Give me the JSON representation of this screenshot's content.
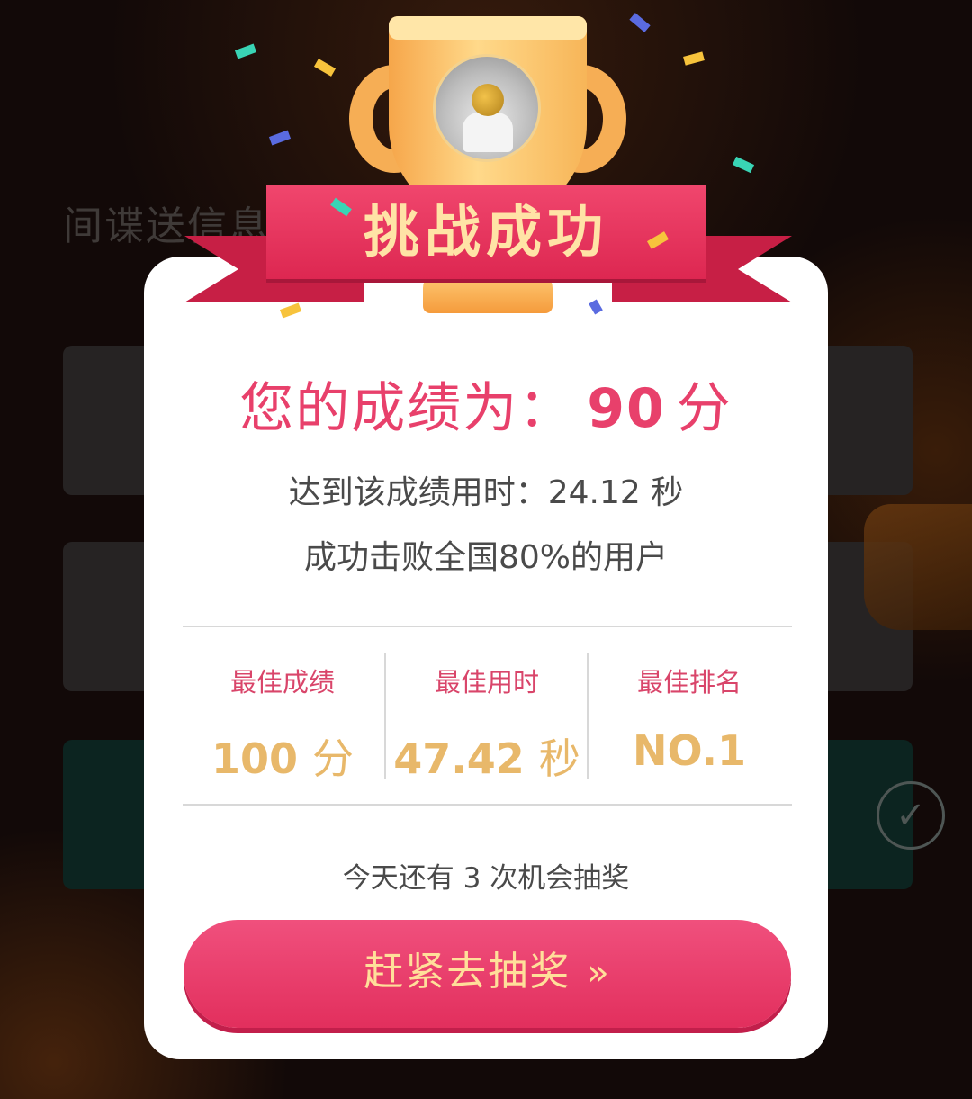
{
  "background": {
    "question_title": "间谍送信息"
  },
  "banner": {
    "title": "挑战成功"
  },
  "result": {
    "score_prefix": "您的成绩为：",
    "score_value": "90",
    "score_unit": "分",
    "time_line": "达到该成绩用时：24.12 秒",
    "beat_line": "成功击败全国80%的用户"
  },
  "stats": [
    {
      "label": "最佳成绩",
      "value": "100",
      "unit": "分"
    },
    {
      "label": "最佳用时",
      "value": "47.42",
      "unit": "秒"
    },
    {
      "label": "最佳排名",
      "value": "NO.1",
      "unit": ""
    }
  ],
  "lottery": {
    "chances_text": "今天还有 3 次机会抽奖",
    "button_label": "赶紧去抽奖",
    "button_icon": "double-chevron-right-icon",
    "button_glyph": "»"
  },
  "colors": {
    "accent_pink": "#e8406b",
    "gold": "#e8b86a",
    "button_text": "#ffdf9a"
  }
}
